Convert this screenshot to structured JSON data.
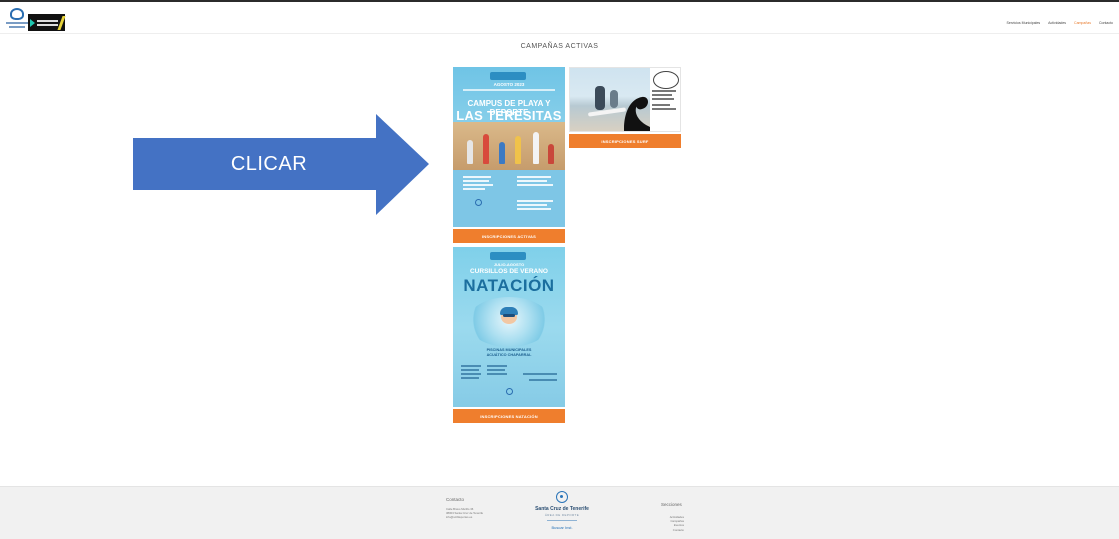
{
  "header": {
    "nav": [
      {
        "label": "Servicios Municipales",
        "active": false
      },
      {
        "label": "Actividades",
        "active": false
      },
      {
        "label": "Campañas",
        "active": true
      },
      {
        "label": "Contacto",
        "active": false
      }
    ]
  },
  "page": {
    "title": "CAMPAÑAS ACTIVAS"
  },
  "overlay": {
    "arrow_label": "CLICAR",
    "arrow_color": "#4472c4"
  },
  "campaigns": [
    {
      "poster": {
        "top_line": "AGOSTO 2023",
        "headline": "CAMPUS DE PLAYA Y DEPORTE",
        "place": "LAS TERESITAS"
      },
      "cta": "INSCRIPCIONES ACTIVAS"
    },
    {
      "poster": {},
      "cta": "INSCRIPCIONES SURF"
    },
    {
      "poster": {
        "top_line": "JULIO-AGOSTO",
        "subtitle": "CURSILLOS DE VERANO",
        "headline": "NATACIÓN",
        "place_line1": "PISCINAS MUNICIPALES",
        "place_line2": "ACUÁTICO CHAPARRAL"
      },
      "cta": "INSCRIPCIONES NATACIÓN"
    }
  ],
  "footer": {
    "contact_heading": "Contacto",
    "contact_lines": [
      "Calle Bravo Murillo 36",
      "38003 Santa Cruz de Tenerife",
      "info@sctfdeportes.es"
    ],
    "city": "Santa Cruz de Tenerife",
    "dept": "ÁREA DE DEPORTE",
    "link": "Buscar Inst.",
    "sections_heading": "Secciones",
    "sections": [
      "Actividades",
      "Campañas",
      "Eventos",
      "Contacto"
    ]
  },
  "colors": {
    "accent": "#ef7e2d",
    "brand_blue": "#2a74b8"
  }
}
